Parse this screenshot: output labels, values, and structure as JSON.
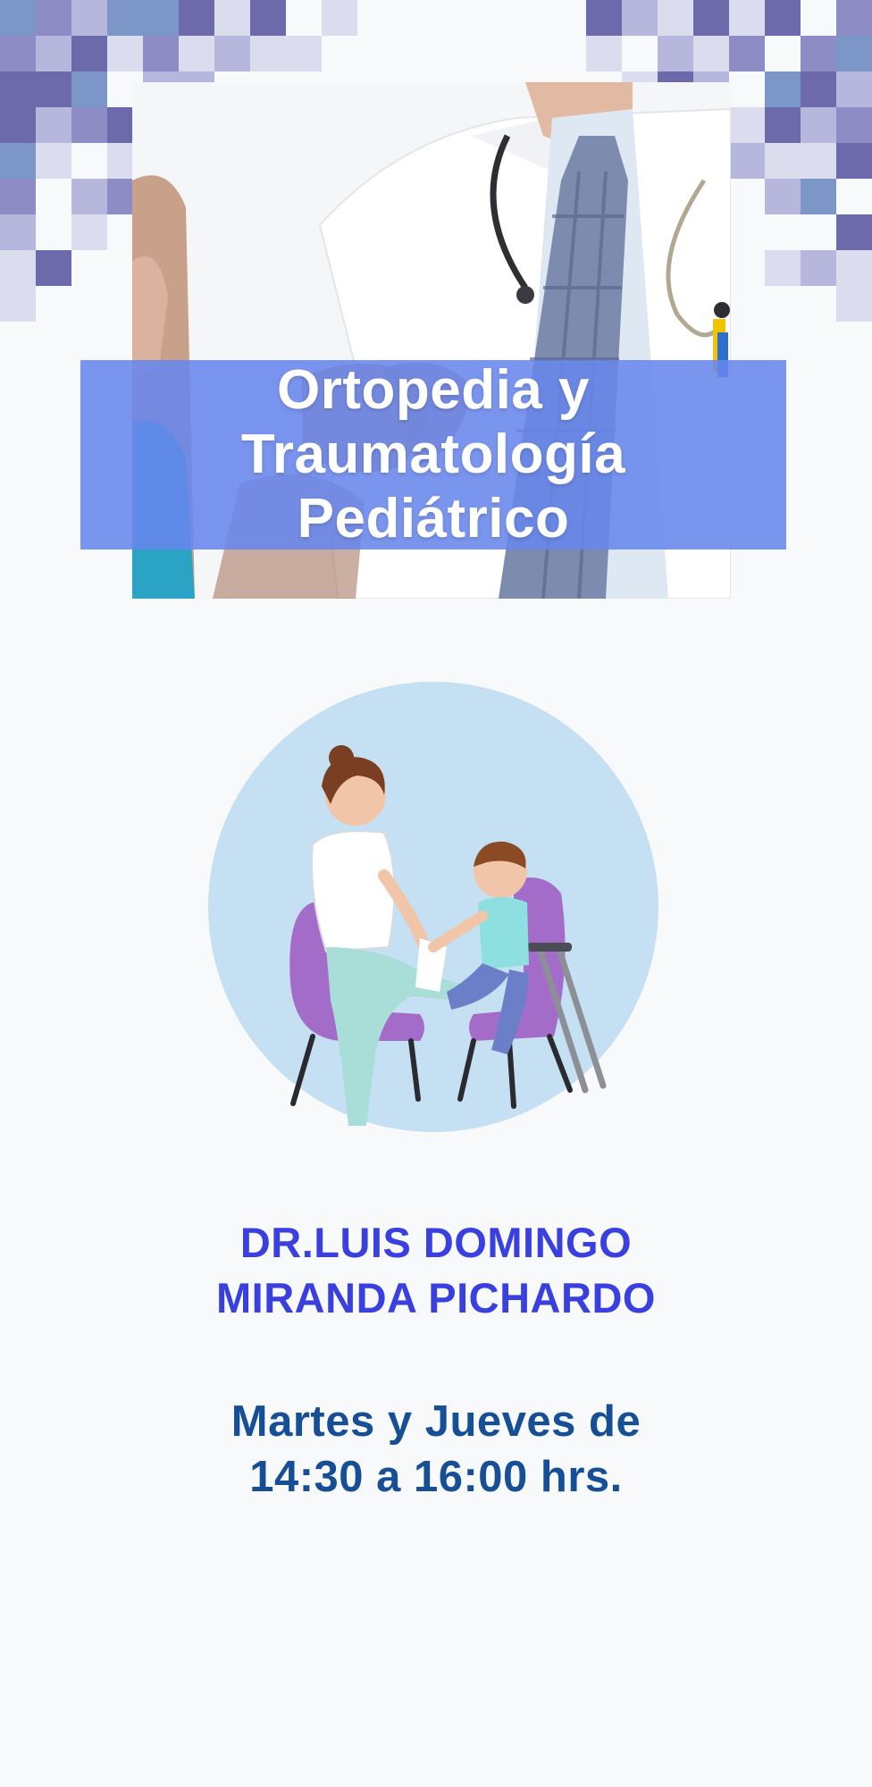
{
  "banner": {
    "title_lines": [
      "Ortopedia y",
      "Traumatología",
      "Pediátrico"
    ],
    "band_color": "#6886ec"
  },
  "doctor": {
    "name_lines": [
      "DR.LUIS DOMINGO",
      "MIRANDA PICHARDO"
    ],
    "color": "#3a40e0"
  },
  "schedule": {
    "lines": [
      "Martes y Jueves de",
      "14:30 a 16:00 hrs."
    ],
    "color": "#174f96"
  },
  "decor": {
    "mosaic_colors": [
      "#6d6aac",
      "#8e8cc4",
      "#b7b6dc",
      "#dcdcef",
      "#7c96c8"
    ],
    "illustration_bg": "#c5e0f2",
    "chair_color": "#a46cc9"
  }
}
